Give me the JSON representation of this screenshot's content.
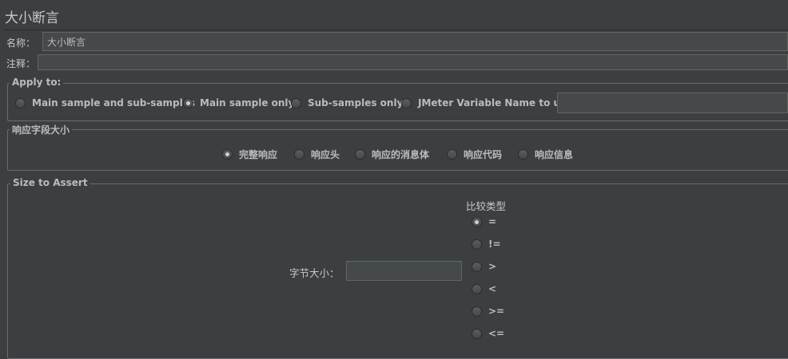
{
  "title": "大小断言",
  "name_label": "名称：",
  "name_value": "大小断言",
  "comment_label": "注释：",
  "comment_value": "",
  "apply_to": {
    "legend": "Apply to:",
    "options": [
      "Main sample and sub-samples",
      "Main sample only",
      "Sub-samples only",
      "JMeter Variable Name to use"
    ],
    "selected": "Main sample only",
    "variable_value": ""
  },
  "response_field": {
    "legend": "响应字段大小",
    "options": [
      "完整响应",
      "响应头",
      "响应的消息体",
      "响应代码",
      "响应信息"
    ],
    "selected": "完整响应"
  },
  "size_assert": {
    "legend": "Size to Assert",
    "byte_label": "字节大小：",
    "byte_value": "",
    "compare_title": "比较类型",
    "compare_options": [
      "=",
      "!=",
      ">",
      "<",
      ">=",
      "<="
    ],
    "selected": "="
  }
}
